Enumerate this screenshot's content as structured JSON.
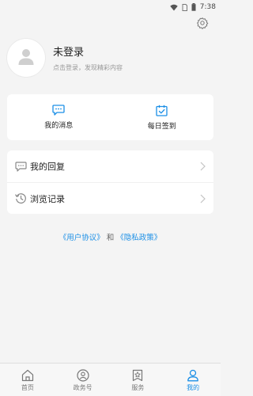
{
  "status_bar": {
    "time": "7:38",
    "icons": [
      "wifi-icon",
      "sim-icon",
      "battery-icon"
    ]
  },
  "header": {
    "settings_icon": "gear-icon"
  },
  "profile": {
    "title": "未登录",
    "subtitle": "点击登录，发现精彩内容",
    "avatar_icon": "user-silhouette-icon"
  },
  "quick_actions": [
    {
      "label": "我的消息",
      "icon": "message-icon"
    },
    {
      "label": "每日签到",
      "icon": "calendar-check-icon"
    }
  ],
  "menu": [
    {
      "label": "我的回复",
      "icon": "comment-icon"
    },
    {
      "label": "浏览记录",
      "icon": "history-icon"
    }
  ],
  "agreement": {
    "user_agreement": "《用户协议》",
    "and": "和",
    "privacy_policy": "《隐私政策》"
  },
  "tabs": [
    {
      "label": "首页",
      "icon": "home-icon",
      "active": false
    },
    {
      "label": "政务号",
      "icon": "gov-account-icon",
      "active": false
    },
    {
      "label": "服务",
      "icon": "service-icon",
      "active": false
    },
    {
      "label": "我的",
      "icon": "person-icon",
      "active": true
    }
  ],
  "colors": {
    "accent": "#1b8fe6",
    "background": "#f4f4f4",
    "card": "#ffffff"
  }
}
